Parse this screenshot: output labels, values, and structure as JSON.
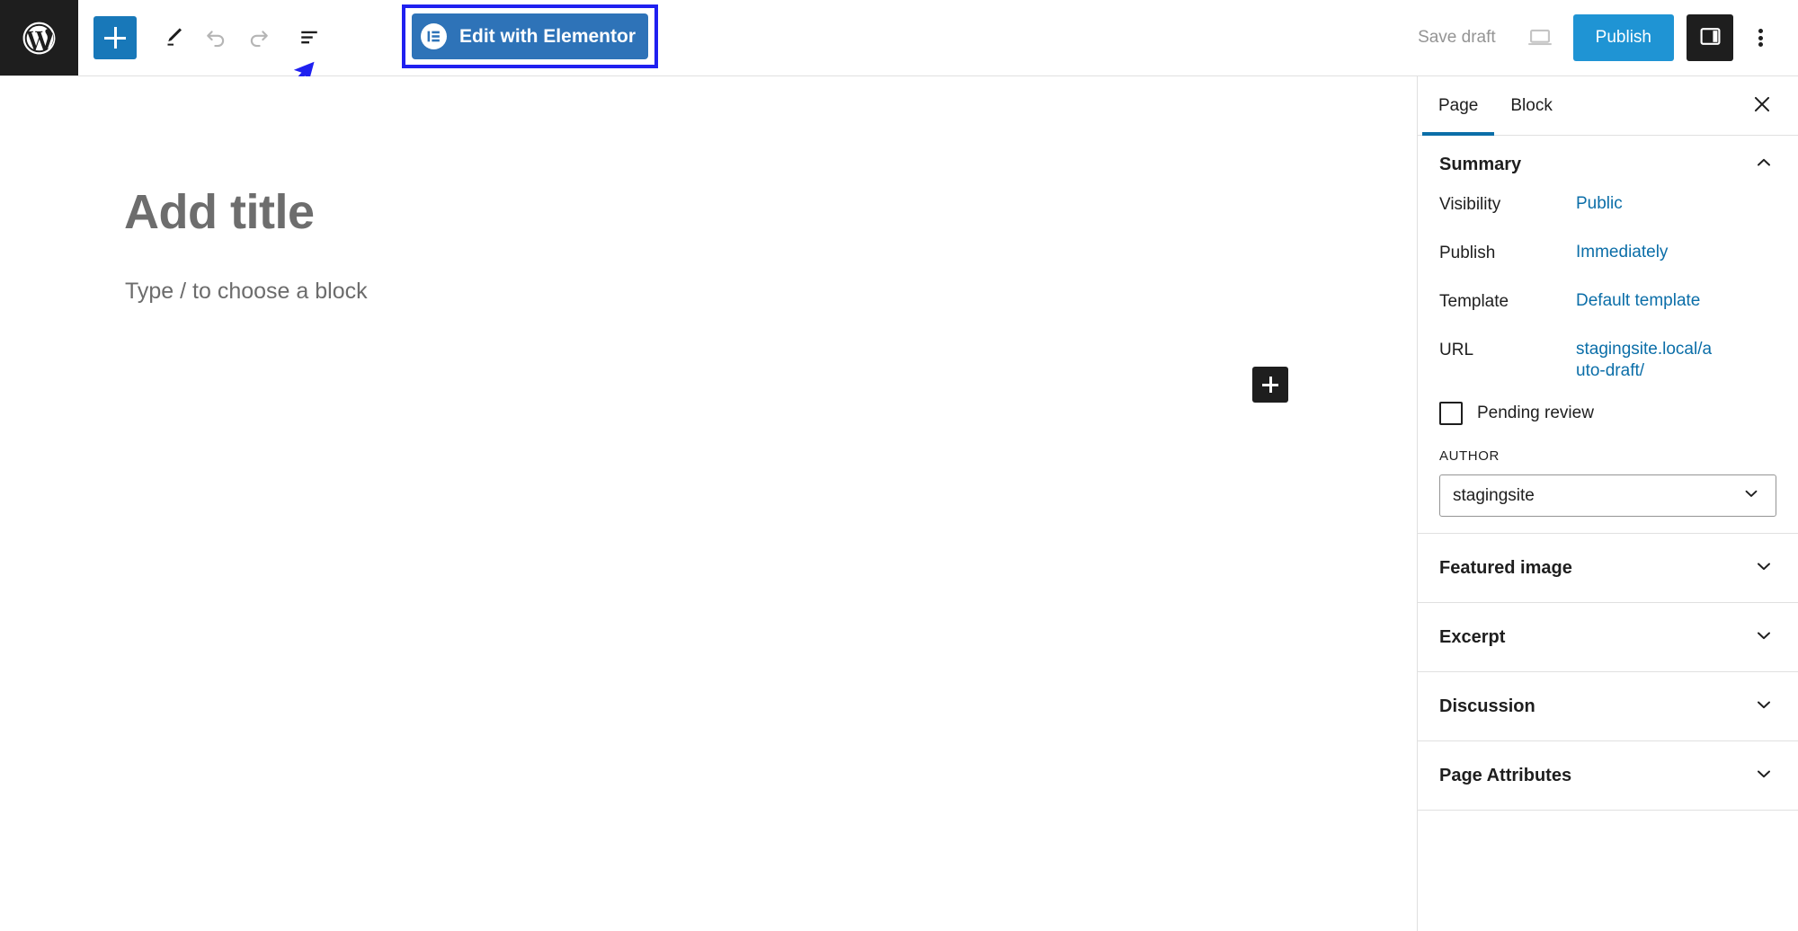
{
  "topbar": {
    "logo_icon": "wordpress-logo-icon",
    "add_block_label": "+",
    "add_block_icon": "plus-icon",
    "tools_icon": "pencil-tools-icon",
    "undo_icon": "undo-arrow-icon",
    "redo_icon": "redo-arrow-icon",
    "list_view_icon": "document-outline-icon",
    "elementor": {
      "label": "Edit with Elementor",
      "icon": "elementor-logo-icon",
      "button_color": "#2e73b8",
      "highlight_color": "#1f20f0"
    },
    "save_draft_label": "Save draft",
    "preview_icon": "laptop-preview-icon",
    "publish_label": "Publish",
    "publish_color": "#1f94d4",
    "sidebar_toggle_icon": "settings-panel-icon",
    "options_icon": "three-dots-vertical-icon"
  },
  "annotation": {
    "arrow_icon": "pointer-arrow-icon",
    "arrow_color": "#1f20f0"
  },
  "canvas": {
    "title_placeholder": "Add title",
    "block_placeholder": "Type / to choose a block",
    "inserter_icon": "plus-icon"
  },
  "sidebar": {
    "tabs": [
      {
        "label": "Page",
        "active": true
      },
      {
        "label": "Block",
        "active": false
      }
    ],
    "close_icon": "close-x-icon",
    "accent_color": "#0b6ea8",
    "summary": {
      "title": "Summary",
      "collapse_icon": "chevron-up-icon",
      "rows": [
        {
          "label": "Visibility",
          "value": "Public"
        },
        {
          "label": "Publish",
          "value": "Immediately"
        },
        {
          "label": "Template",
          "value": "Default template"
        },
        {
          "label": "URL",
          "value": "stagingsite.local/auto-draft/"
        }
      ],
      "pending_review": {
        "label": "Pending review",
        "checked": false,
        "icon": "checkbox-icon"
      },
      "author": {
        "caption": "AUTHOR",
        "value": "stagingsite",
        "dropdown_icon": "chevron-down-icon"
      }
    },
    "accordions": [
      {
        "label": "Featured image",
        "icon": "chevron-down-icon"
      },
      {
        "label": "Excerpt",
        "icon": "chevron-down-icon"
      },
      {
        "label": "Discussion",
        "icon": "chevron-down-icon"
      },
      {
        "label": "Page Attributes",
        "icon": "chevron-down-icon"
      }
    ]
  }
}
